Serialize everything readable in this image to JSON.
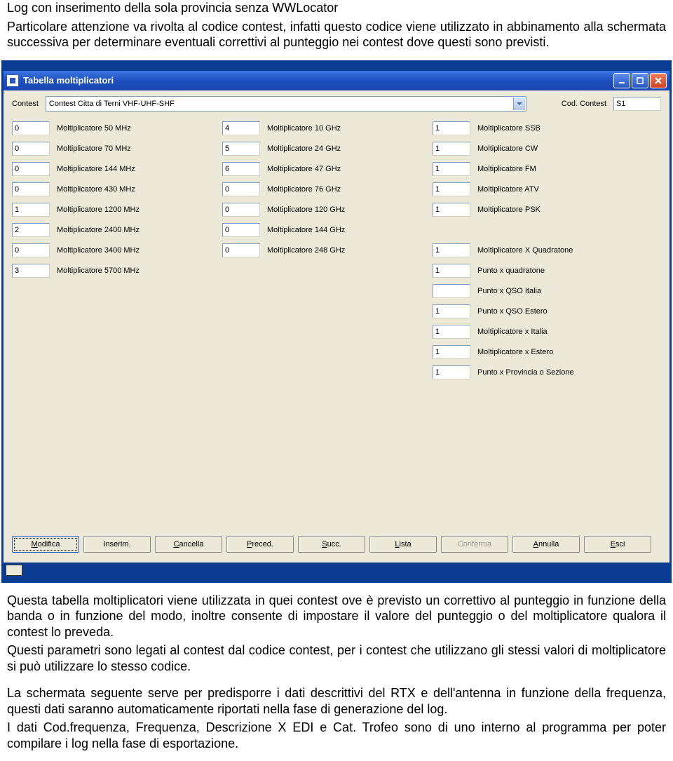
{
  "doc": {
    "para1_line1": "Log con inserimento della sola provincia senza  WWLocator",
    "para1_line2": "Particolare attenzione va rivolta al codice contest, infatti questo codice viene utilizzato in abbinamento alla schermata successiva per determinare eventuali correttivi al punteggio nei contest dove questi sono previsti.",
    "para2": "Questa tabella moltiplicatori viene utilizzata in quei contest ove è previsto un correttivo al punteggio in funzione della banda o in funzione del modo, inoltre consente di impostare il valore del punteggio o del moltiplicatore qualora il contest lo preveda.",
    "para3": "Questi parametri sono legati al contest dal codice contest, per i contest che utilizzano gli stessi valori di moltiplicatore si può utilizzare lo stesso codice.",
    "para4": "La schermata seguente serve per predisporre i dati descrittivi del RTX e dell'antenna in funzione della frequenza, questi dati saranno automaticamente riportati nella fase di generazione del log.",
    "para5": "I dati Cod.frequenza, Frequenza, Descrizione X EDI e Cat. Trofeo sono di uno interno al programma per poter compilare i log nella fase di esportazione."
  },
  "window": {
    "title": "Tabella moltiplicatori",
    "contest_label": "Contest",
    "contest_value": "Contest Citta di Terni VHF-UHF-SHF",
    "cod_contest_label": "Cod. Contest",
    "cod_contest_value": "S1",
    "col1": [
      {
        "v": "0",
        "l": "Moltiplicatore 50 MHz"
      },
      {
        "v": "0",
        "l": "Moltiplicatore 70 MHz"
      },
      {
        "v": "0",
        "l": "Moltiplicatore 144 MHz"
      },
      {
        "v": "0",
        "l": "Moltiplicatore 430 MHz"
      },
      {
        "v": "1",
        "l": "Moltiplicatore 1200 MHz"
      },
      {
        "v": "2",
        "l": "Moltiplicatore 2400 MHz"
      },
      {
        "v": "0",
        "l": "Moltiplicatore 3400 MHz"
      },
      {
        "v": "3",
        "l": "Moltiplicatore 5700 MHz"
      }
    ],
    "col2": [
      {
        "v": "4",
        "l": "Moltiplicatore 10 GHz"
      },
      {
        "v": "5",
        "l": "Moltiplicatore 24 GHz"
      },
      {
        "v": "6",
        "l": "Moltiplicatore 47 GHz"
      },
      {
        "v": "0",
        "l": "Moltiplicatore 76 GHz"
      },
      {
        "v": "0",
        "l": "Moltiplicatore 120 GHz"
      },
      {
        "v": "0",
        "l": "Moltiplicatore 144 GHz"
      },
      {
        "v": "0",
        "l": "Moltiplicatore 248 GHz"
      }
    ],
    "col3": [
      {
        "v": "1",
        "l": "Moltiplicatore SSB"
      },
      {
        "v": "1",
        "l": "Moltiplicatore CW"
      },
      {
        "v": "1",
        "l": "Moltiplicatore FM"
      },
      {
        "v": "1",
        "l": "Moltiplicatore ATV"
      },
      {
        "v": "1",
        "l": "Moltiplicatore PSK"
      },
      {
        "v": "",
        "l": ""
      },
      {
        "v": "1",
        "l": "Moltiplicatore X Quadratone"
      },
      {
        "v": "1",
        "l": "Punto x quadratone"
      },
      {
        "v": "",
        "l": "Punto x QSO Italia"
      },
      {
        "v": "1",
        "l": "Punto x QSO Estero"
      },
      {
        "v": "1",
        "l": "Moltiplicatore x Italia"
      },
      {
        "v": "1",
        "l": "Moltiplicatore x Estero"
      },
      {
        "v": "1",
        "l": "Punto x Provincia o Sezione"
      }
    ],
    "buttons": {
      "modifica": "Modifica",
      "inserim": "Inserim.",
      "cancella": "Cancella",
      "preced": "Preced.",
      "succ": "Succ.",
      "lista": "Lista",
      "conferma": "Conferma",
      "annulla": "Annulla",
      "esci": "Esci"
    }
  }
}
